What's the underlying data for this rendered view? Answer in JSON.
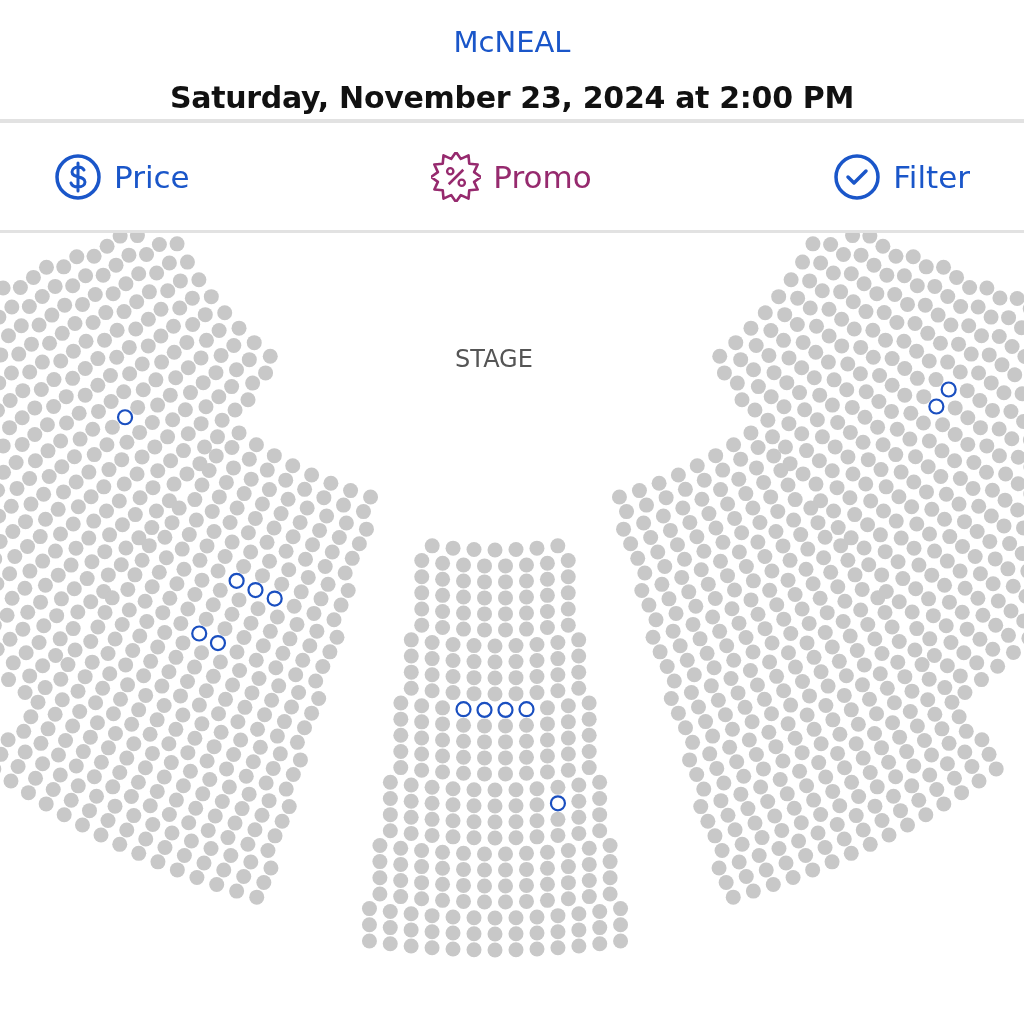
{
  "show": {
    "title": "McNEAL",
    "datetime": "Saturday, November 23, 2024 at 2:00 PM"
  },
  "toolbar": [
    {
      "kind": "price",
      "label": "Price",
      "color": "#1a56c9"
    },
    {
      "kind": "promo",
      "label": "Promo",
      "color": "#962a6e"
    },
    {
      "kind": "filter",
      "label": "Filter",
      "color": "#1a56c9"
    }
  ],
  "seat_map": {
    "stage_label": "STAGE"
  }
}
